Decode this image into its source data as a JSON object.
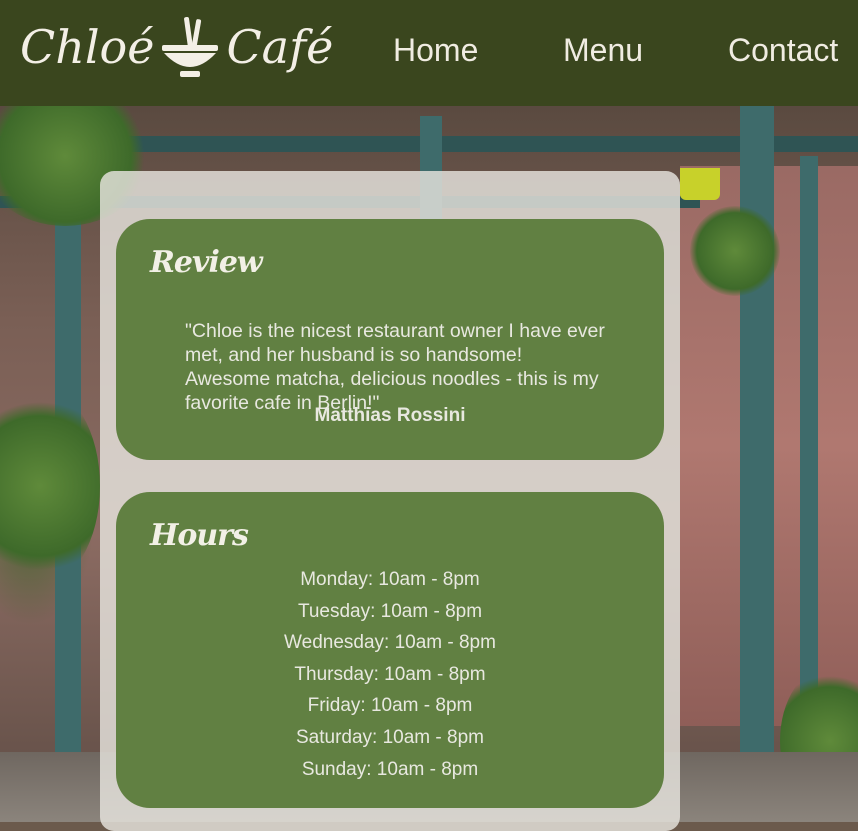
{
  "brand": {
    "name_left": "Chloé",
    "name_right": "Café"
  },
  "nav": {
    "items": [
      "Home",
      "Menu",
      "Contact"
    ]
  },
  "review": {
    "title": "Review",
    "quote": "\"Chloe is the nicest restaurant owner I have ever met, and her husband is so handsome! Awesome matcha, delicious noodles - this is my favorite cafe in Berlin!\"",
    "author": "Matthias Rossini"
  },
  "hours": {
    "title": "Hours",
    "days": [
      "Monday: 10am - 8pm",
      "Tuesday: 10am - 8pm",
      "Wednesday: 10am - 8pm",
      "Thursday: 10am - 8pm",
      "Friday: 10am - 8pm",
      "Saturday: 10am - 8pm",
      "Sunday: 10am - 8pm"
    ]
  },
  "colors": {
    "header_bg": "#3a461e",
    "card_bg": "#618042",
    "panel_bg": "rgba(230,228,222,0.82)",
    "text_light": "#e8e8e0"
  },
  "icons": {
    "logo_icon": "noodle-bowl-with-chopsticks-icon"
  }
}
